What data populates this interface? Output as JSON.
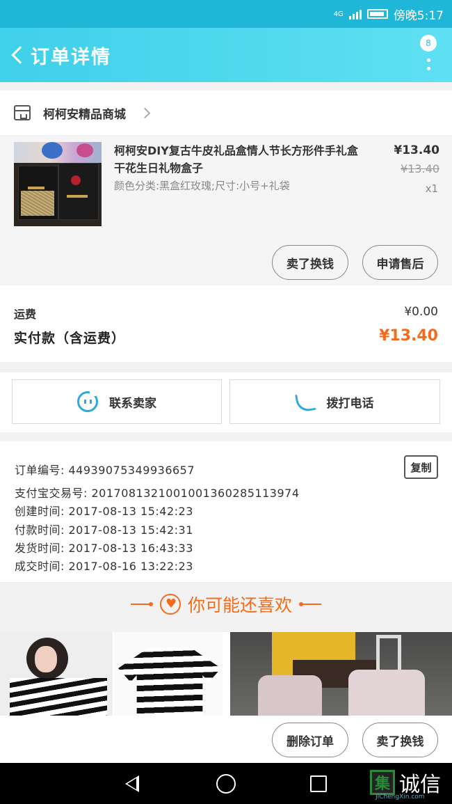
{
  "status_bar": {
    "time": "傍晚5:17",
    "network": "4G"
  },
  "header": {
    "title": "订单详情",
    "badge_count": "8"
  },
  "shop": {
    "name": "柯柯安精品商城"
  },
  "product": {
    "name": "柯柯安DIY复古牛皮礼品盒情人节长方形件手礼盒干花生日礼物盒子",
    "spec": "颜色分类:黑盒红玫瑰;尺寸:小号+礼袋",
    "price": "¥13.40",
    "original_price": "¥13.40",
    "quantity": "x1",
    "refund_button": "卖了换钱",
    "after_sale_button": "申请售后"
  },
  "fees": {
    "shipping_label": "运费",
    "shipping_value": "¥0.00",
    "total_label": "实付款（含运费）",
    "total_value": "¥13.40"
  },
  "contact": {
    "seller_button": "联系卖家",
    "phone_button": "拨打电话"
  },
  "order_info": {
    "order_no": "订单编号: 44939075349936657",
    "alipay_no": "支付宝交易号: 2017081321001001360285113974",
    "created": "创建时间: 2017-08-13 15:42:23",
    "paid": "付款时间: 2017-08-13 15:42:31",
    "shipped": "发货时间: 2017-08-13 16:43:33",
    "closed": "成交时间: 2017-08-16 13:22:23",
    "copy_button": "复制"
  },
  "recommend": {
    "title": "你可能还喜欢"
  },
  "bottom": {
    "delete_button": "删除订单",
    "refund_button": "卖了换钱"
  },
  "watermark": {
    "char": "集",
    "text": "诚信",
    "url": "JiChengXin.com"
  },
  "colors": {
    "header_bg": "#3fd0ea",
    "accent_orange": "#f36b1c",
    "icon_blue": "#2ea8de"
  },
  "icons": [
    "back-icon",
    "more-icon",
    "shop-icon",
    "chevron-right-icon",
    "chat-icon",
    "phone-icon",
    "heart-icon",
    "nav-back-icon",
    "nav-home-icon",
    "nav-recent-icon"
  ]
}
